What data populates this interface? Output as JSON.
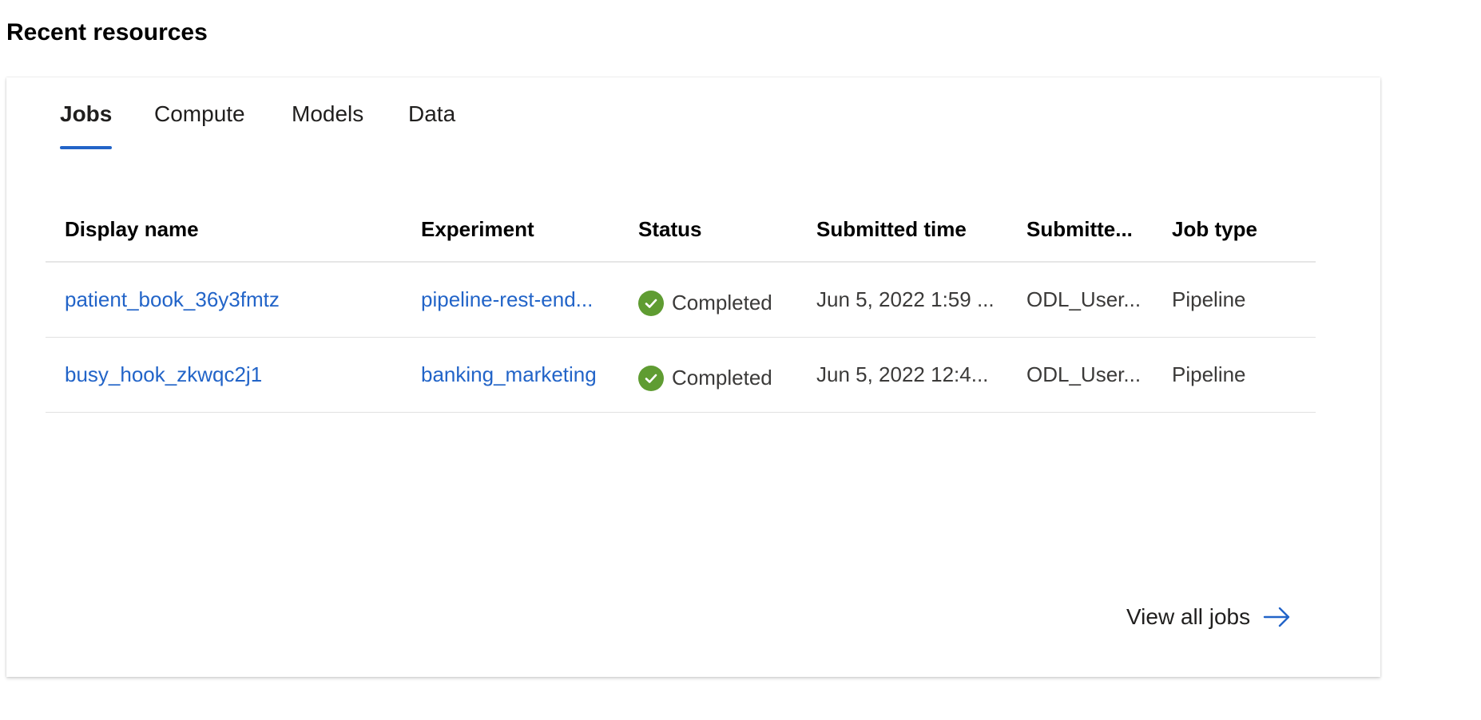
{
  "section": {
    "title": "Recent resources"
  },
  "tabs": [
    {
      "label": "Jobs",
      "active": true
    },
    {
      "label": "Compute",
      "active": false
    },
    {
      "label": "Models",
      "active": false
    },
    {
      "label": "Data",
      "active": false
    }
  ],
  "table": {
    "headers": [
      "Display name",
      "Experiment",
      "Status",
      "Submitted time",
      "Submitte...",
      "Job type"
    ],
    "rows": [
      {
        "display_name": "patient_book_36y3fmtz",
        "experiment": "pipeline-rest-end...",
        "status": "Completed",
        "submitted_time": "Jun 5, 2022 1:59 ...",
        "submitted_by": "ODL_User...",
        "job_type": "Pipeline"
      },
      {
        "display_name": "busy_hook_zkwqc2j1",
        "experiment": "banking_marketing",
        "status": "Completed",
        "submitted_time": "Jun 5, 2022 12:4...",
        "submitted_by": "ODL_User...",
        "job_type": "Pipeline"
      }
    ]
  },
  "footer": {
    "view_all_label": "View all jobs"
  },
  "colors": {
    "accent": "#2264c8",
    "success": "#5f9c32"
  },
  "icons": {
    "status": "check-circle-icon",
    "view_all": "arrow-right-icon"
  }
}
